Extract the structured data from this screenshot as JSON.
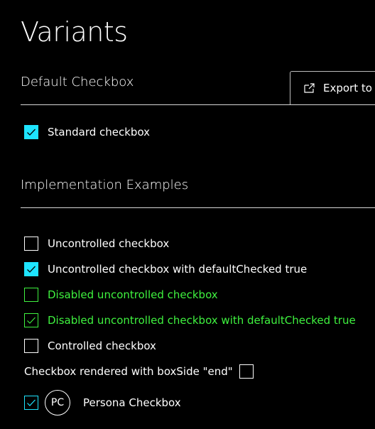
{
  "page": {
    "title": "Variants"
  },
  "export_button": {
    "label": "Export to"
  },
  "sections": {
    "default": {
      "title": "Default Checkbox",
      "items": [
        {
          "label": "Standard checkbox",
          "checked": true,
          "disabled": false
        }
      ]
    },
    "implementation": {
      "title": "Implementation Examples",
      "items": [
        {
          "label": "Uncontrolled checkbox",
          "checked": false,
          "disabled": false
        },
        {
          "label": "Uncontrolled checkbox with defaultChecked true",
          "checked": true,
          "disabled": false
        },
        {
          "label": "Disabled uncontrolled checkbox",
          "checked": false,
          "disabled": true
        },
        {
          "label": "Disabled uncontrolled checkbox with defaultChecked true",
          "checked": true,
          "disabled": true
        },
        {
          "label": "Controlled checkbox",
          "checked": false,
          "disabled": false
        },
        {
          "label": "Checkbox rendered with boxSide \"end\"",
          "checked": false,
          "disabled": false
        }
      ]
    },
    "persona": {
      "initials": "PC",
      "label": "Persona Checkbox",
      "checked": true
    }
  },
  "colors": {
    "background": "#000000",
    "text": "#ffffff",
    "accent_checked": "#1ee4ff",
    "disabled": "#3ff23f",
    "divider": "#d8d8d8"
  }
}
